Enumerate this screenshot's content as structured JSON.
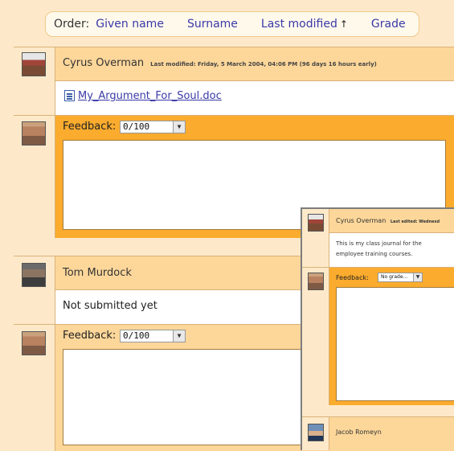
{
  "order_bar": {
    "label": "Order:",
    "links": [
      "Given name",
      "Surname",
      "Last modified",
      "Grade"
    ],
    "sort_arrow": "↑"
  },
  "submissions": [
    {
      "student_name": "Cyrus Overman",
      "last_modified": "Last modified: Friday, 5 March 2004, 04:06 PM (96 days 16 hours early)",
      "file_name": "My_Argument_For_Soul.doc",
      "feedback_label": "Feedback:",
      "grade_value": "0/100",
      "feedback_text": ""
    },
    {
      "student_name": "Tom Murdock",
      "status": "Not submitted yet",
      "feedback_label": "Feedback:",
      "grade_value": "0/100",
      "feedback_text": ""
    }
  ],
  "inset": {
    "student_name": "Cyrus Overman",
    "last_edited": "Last edited: Wednesd",
    "journal_text_1": "This is my class journal for the",
    "journal_text_2": "employee training courses.",
    "feedback_label": "Feedback:",
    "grade_value": "No grade...",
    "next_student": "Jacob Romeyn"
  },
  "colors": {
    "background": "#fde9c9",
    "header": "#fdd79a",
    "feedback_area": "#fbab2d",
    "link": "#3a3aa8"
  }
}
